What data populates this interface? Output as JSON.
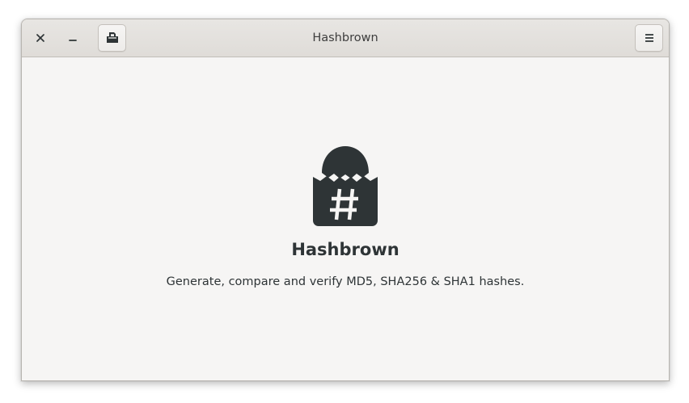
{
  "window": {
    "title": "Hashbrown"
  },
  "headerbar": {
    "close_icon": "close-icon",
    "minimize_icon": "minimize-icon",
    "open_file_icon": "document-open-icon",
    "menu_icon": "hamburger-menu-icon"
  },
  "welcome": {
    "app_icon": "hashbrown-logo-icon",
    "app_name": "Hashbrown",
    "description": "Generate, compare and verify MD5, SHA256 & SHA1 hashes."
  },
  "colors": {
    "window_bg": "#f6f5f4",
    "headerbar_bg": "#dfdcd8",
    "icon_dark": "#2e3436",
    "text": "#2e3436"
  }
}
